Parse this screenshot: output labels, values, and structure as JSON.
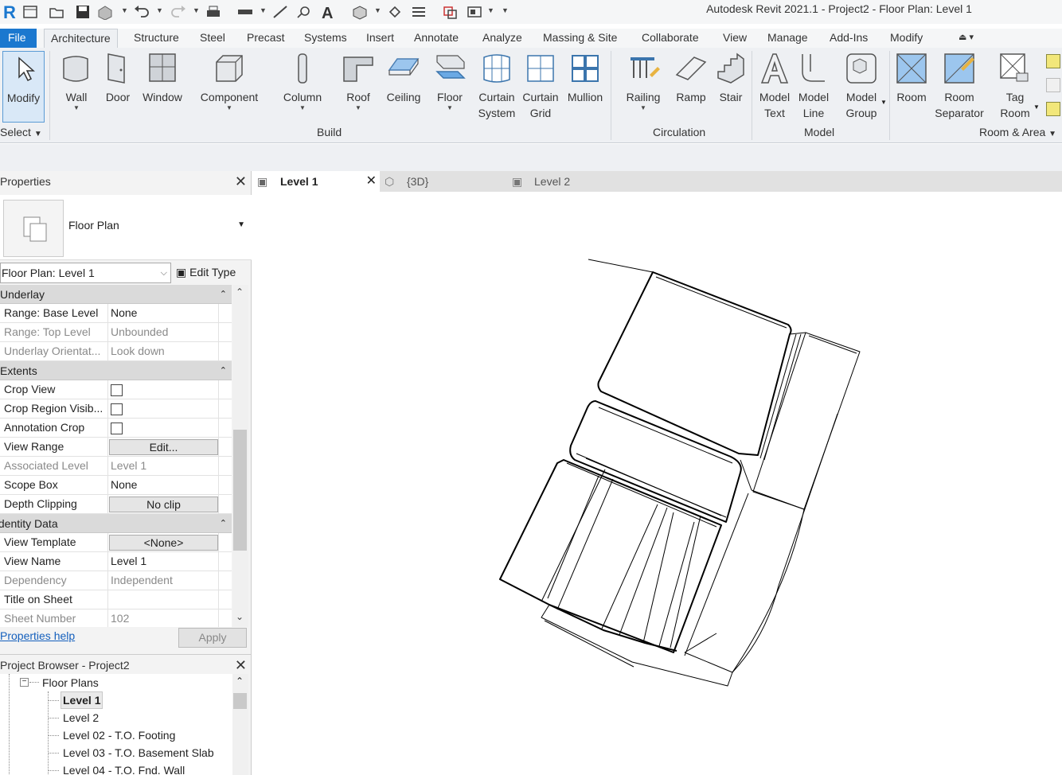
{
  "window": {
    "title": "Autodesk Revit 2021.1 - Project2 - Floor Plan: Level 1"
  },
  "ribbon_tabs": [
    "File",
    "Architecture",
    "Structure",
    "Steel",
    "Precast",
    "Systems",
    "Insert",
    "Annotate",
    "Analyze",
    "Massing & Site",
    "Collaborate",
    "View",
    "Manage",
    "Add-Ins",
    "Modify"
  ],
  "ribbon": {
    "modify": "Modify",
    "select_panel": "Select",
    "build": {
      "label": "Build",
      "buttons": [
        "Wall",
        "Door",
        "Window",
        "Component",
        "Column",
        "Roof",
        "Ceiling",
        "Floor",
        "Curtain System",
        "Curtain Grid",
        "Mullion"
      ]
    },
    "circulation": {
      "label": "Circulation",
      "buttons": [
        "Railing",
        "Ramp",
        "Stair"
      ]
    },
    "model": {
      "label": "Model",
      "buttons": [
        "Model Text",
        "Model Line",
        "Model Group"
      ]
    },
    "room_area": {
      "label": "Room & Area",
      "buttons": [
        "Room",
        "Room Separator",
        "Tag Room"
      ]
    }
  },
  "properties": {
    "title": "Properties",
    "type_name": "Floor Plan",
    "instance_filter": "Floor Plan: Level 1",
    "edit_type": "Edit Type",
    "groups": [
      {
        "name": "Underlay",
        "rows": [
          {
            "name": "Range: Base Level",
            "value": "None",
            "enabled": true
          },
          {
            "name": "Range: Top Level",
            "value": "Unbounded",
            "enabled": false
          },
          {
            "name": "Underlay Orientat...",
            "value": "Look down",
            "enabled": false
          }
        ]
      },
      {
        "name": "Extents",
        "rows": [
          {
            "name": "Crop View",
            "checkbox": false,
            "enabled": true
          },
          {
            "name": "Crop Region Visib...",
            "checkbox": false,
            "enabled": true
          },
          {
            "name": "Annotation Crop",
            "checkbox": false,
            "enabled": true
          },
          {
            "name": "View Range",
            "button": "Edit...",
            "enabled": true
          },
          {
            "name": "Associated Level",
            "value": "Level 1",
            "enabled": false
          },
          {
            "name": "Scope Box",
            "value": "None",
            "enabled": true
          },
          {
            "name": "Depth Clipping",
            "button": "No clip",
            "enabled": true
          }
        ]
      },
      {
        "name": "Identity Data",
        "rows": [
          {
            "name": "View Template",
            "button": "<None>",
            "enabled": true
          },
          {
            "name": "View Name",
            "value": "Level 1",
            "enabled": true
          },
          {
            "name": "Dependency",
            "value": "Independent",
            "enabled": false
          },
          {
            "name": "Title on Sheet",
            "value": "",
            "enabled": true
          },
          {
            "name": "Sheet Number",
            "value": "102",
            "enabled": false
          }
        ]
      }
    ],
    "help_link": "Properties help",
    "apply": "Apply"
  },
  "project_browser": {
    "title": "Project Browser - Project2",
    "root": "Floor Plans",
    "items": [
      "Level 1",
      "Level 2",
      "Level 02 - T.O. Footing",
      "Level 03 - T.O. Basement Slab",
      "Level 04 - T.O. Fnd. Wall"
    ],
    "selected_index": 0
  },
  "view_tabs": [
    {
      "label": "Level 1",
      "active": true
    },
    {
      "label": "{3D}",
      "active": false
    },
    {
      "label": "Level 2",
      "active": false
    }
  ],
  "colors": {
    "file_tab": "#1b78cf",
    "ribbon_bg": "#eef0f3",
    "link": "#1560bd"
  }
}
